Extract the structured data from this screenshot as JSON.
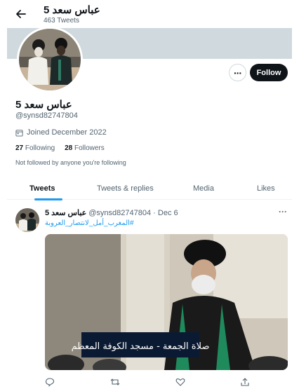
{
  "header": {
    "name": "عباس سعد 5",
    "tweet_count": "463 Tweets"
  },
  "profile": {
    "name": "عباس سعد 5",
    "handle": "@synsd82747804",
    "joined": "Joined December 2022",
    "following_count": "27",
    "following_label": "Following",
    "followers_count": "28",
    "followers_label": "Followers",
    "not_followed": "Not followed by anyone you're following",
    "follow_label": "Follow",
    "more_label": "···"
  },
  "tabs": [
    {
      "label": "Tweets",
      "active": true
    },
    {
      "label": "Tweets & replies",
      "active": false
    },
    {
      "label": "Media",
      "active": false
    },
    {
      "label": "Likes",
      "active": false
    }
  ],
  "tweet": {
    "name": "عباس سعد 5",
    "handle": "@synsd82747804",
    "sep": "·",
    "date": "Dec 6",
    "hashtag": "#المغرب_أمل_لانتصار_العروبة",
    "image_caption": "صلاة الجمعة - مسجد الكوفة المعظم",
    "more_label": "···"
  },
  "colors": {
    "accent": "#1d9bf0",
    "text_primary": "#0f1419",
    "text_secondary": "#536471",
    "follow_bg": "#0f1419",
    "banner": "#cfd9de"
  },
  "icons": [
    "back-arrow-icon",
    "calendar-icon",
    "reply-icon",
    "retweet-icon",
    "like-icon",
    "share-icon"
  ]
}
